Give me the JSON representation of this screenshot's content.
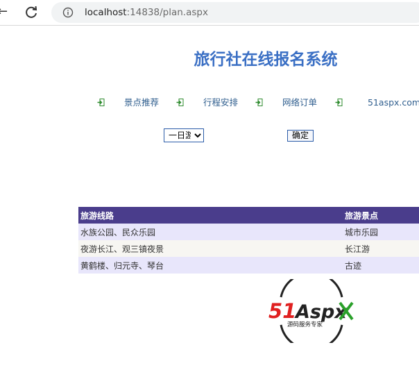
{
  "browser": {
    "url_host": "localhost",
    "url_rest": ":14838/plan.aspx"
  },
  "page": {
    "title": "旅行社在线报名系统"
  },
  "nav": {
    "items": [
      {
        "label": "景点推荐"
      },
      {
        "label": "行程安排"
      },
      {
        "label": "网络订单"
      },
      {
        "label": "51aspx.com"
      }
    ]
  },
  "form": {
    "select_value": "一日游",
    "select_options": [
      "一日游"
    ],
    "confirm_label": "确定"
  },
  "table": {
    "headers": [
      "旅游线路",
      "旅游景点"
    ],
    "rows": [
      [
        "水族公园、民众乐园",
        "城市乐园"
      ],
      [
        "夜游长江、观三镇夜景",
        "长江游"
      ],
      [
        "黄鹤楼、归元寺、琴台",
        "古迹"
      ]
    ]
  },
  "logo": {
    "main_text": "51Aspx",
    "sub_text": "源码服务专家"
  },
  "colors": {
    "title": "#3a6fc4",
    "table_header": "#4a3d8c",
    "row_odd": "#e8e6fb",
    "row_even": "#f7f6f2",
    "nav_icon": "#2e8b2e",
    "logo_red": "#e02020",
    "logo_green": "#2aa02a"
  }
}
